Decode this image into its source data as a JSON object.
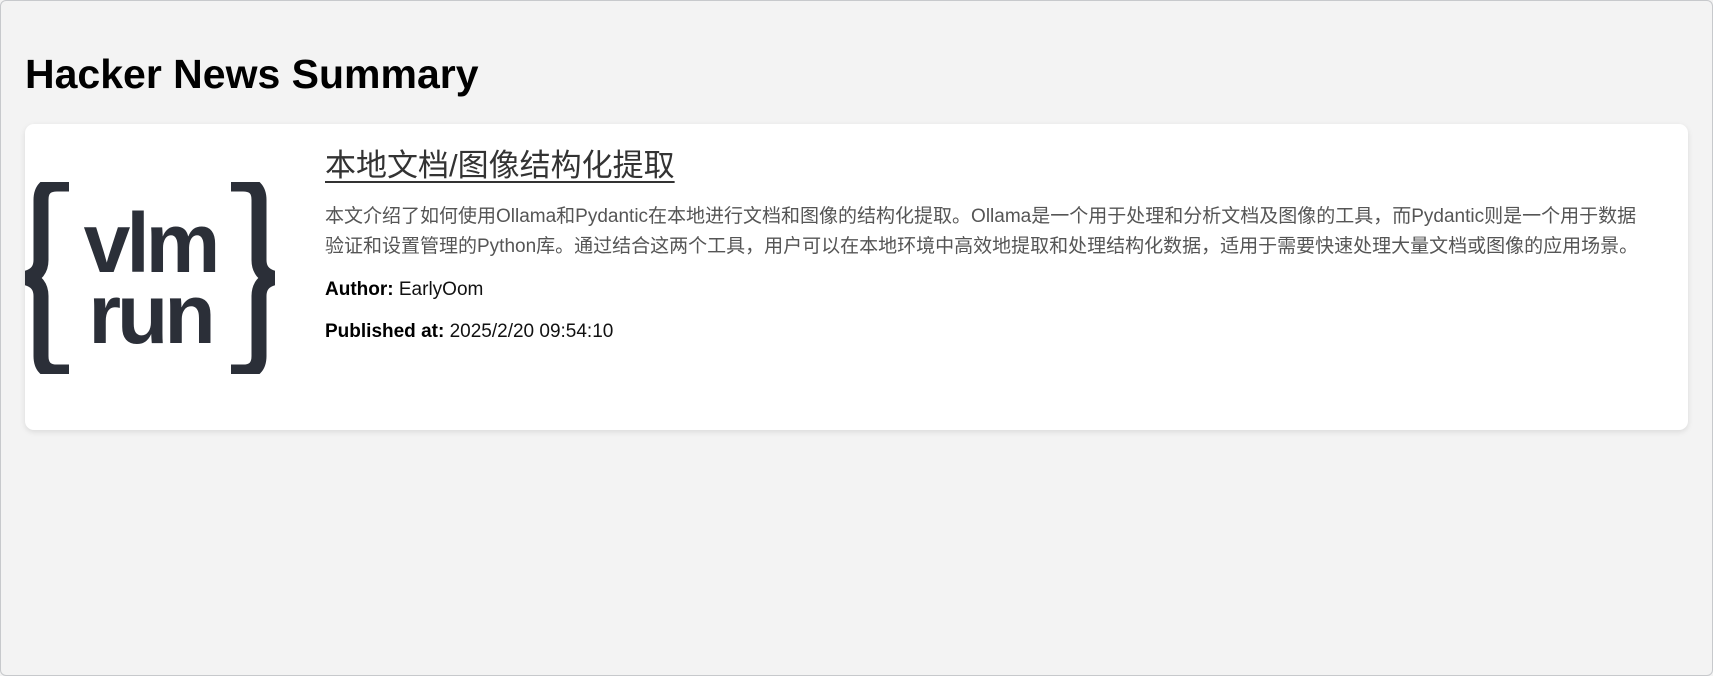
{
  "page": {
    "title": "Hacker News Summary"
  },
  "article": {
    "logo": {
      "line1": "vlm",
      "line2": "run",
      "color": "#2b2f38"
    },
    "title": "本地文档/图像结构化提取",
    "summary": "本文介绍了如何使用Ollama和Pydantic在本地进行文档和图像的结构化提取。Ollama是一个用于处理和分析文档及图像的工具，而Pydantic则是一个用于数据验证和设置管理的Python库。通过结合这两个工具，用户可以在本地环境中高效地提取和处理结构化数据，适用于需要快速处理大量文档或图像的应用场景。",
    "author_label": "Author:",
    "author": "EarlyOom",
    "published_label": "Published at:",
    "published": "2025/2/20 09:54:10"
  },
  "colors": {
    "background": "#f3f3f3",
    "card": "#ffffff",
    "title_link": "#333333",
    "summary_text": "#555555"
  }
}
